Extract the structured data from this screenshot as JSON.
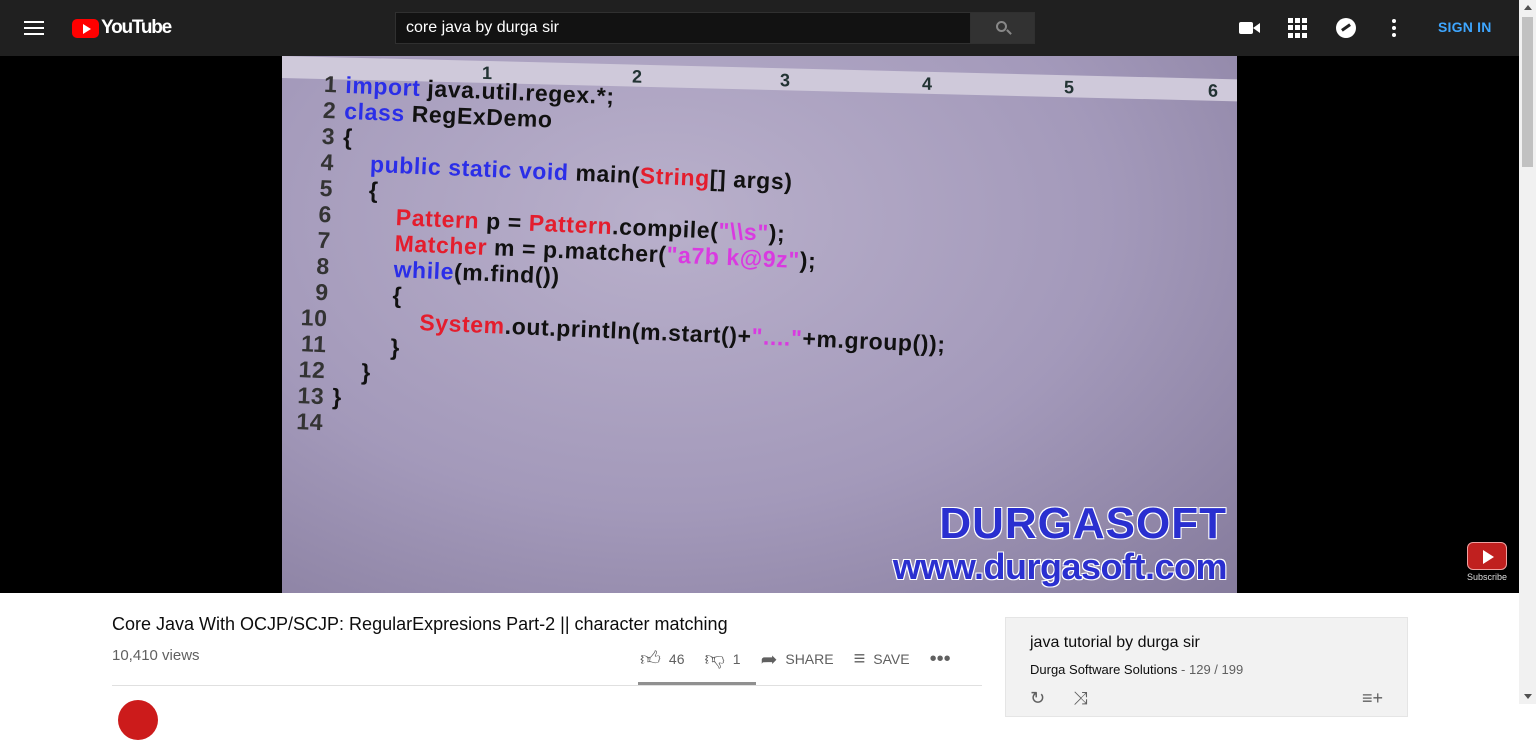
{
  "header": {
    "logo_text": "YouTube",
    "search_value": "core java by durga sir",
    "signin_label": "SIGN IN"
  },
  "player": {
    "ruler_marks": [
      "1",
      "2",
      "3",
      "4",
      "5",
      "6"
    ],
    "code_lines": [
      {
        "num": "1",
        "html": "<span class='kw'>import</span> java.util.regex.*;"
      },
      {
        "num": "2",
        "html": "<span class='kw'>class</span> RegExDemo"
      },
      {
        "num": "3",
        "html": "{"
      },
      {
        "num": "4",
        "html": "    <span class='kw'>public static void</span> main(<span class='ty'>String</span>[] args)"
      },
      {
        "num": "5",
        "html": "    {"
      },
      {
        "num": "6",
        "html": "        <span class='ty'>Pattern</span> p = <span class='ty'>Pattern</span>.compile(<span class='str'>\"\\\\s\"</span>);"
      },
      {
        "num": "7",
        "html": "        <span class='ty'>Matcher</span> m = p.matcher(<span class='str'>\"a7b k@9z\"</span>);"
      },
      {
        "num": "8",
        "html": "        <span class='kw'>while</span>(m.find())"
      },
      {
        "num": "9",
        "html": "        {"
      },
      {
        "num": "10",
        "html": "            <span class='ty'>System</span>.out.println(m.start()+<span class='str'>\"....\"</span>+m.group());"
      },
      {
        "num": "11",
        "html": "        }"
      },
      {
        "num": "12",
        "html": "    }"
      },
      {
        "num": "13",
        "html": "}"
      },
      {
        "num": "14",
        "html": ""
      }
    ],
    "brand_line1": "DURGASOFT",
    "brand_line2": "www.durgasoft.com",
    "subscribe_label": "Subscribe"
  },
  "video": {
    "title": "Core Java With OCJP/SCJP: RegularExpresions Part-2 || character matching",
    "views": "10,410 views",
    "likes": "46",
    "dislikes": "1",
    "share_label": "SHARE",
    "save_label": "SAVE"
  },
  "playlist": {
    "title": "java tutorial by durga sir",
    "owner": "Durga Software Solutions",
    "position": "129 / 199"
  }
}
